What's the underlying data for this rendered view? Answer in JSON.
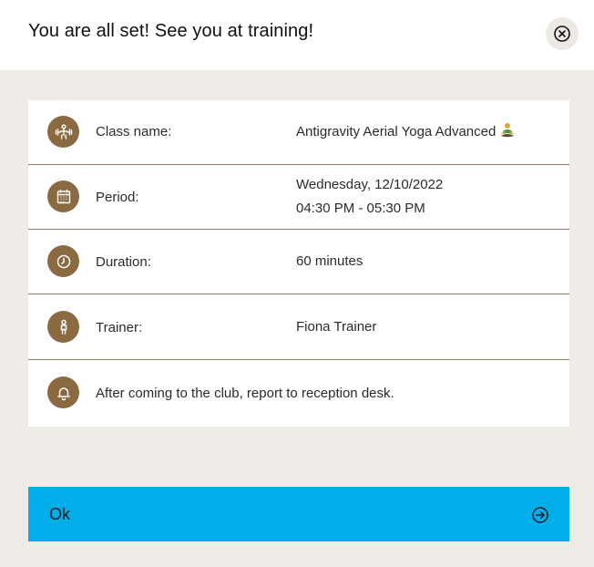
{
  "header": {
    "title": "You are all set! See you at training!",
    "close_icon": "close-circle-icon"
  },
  "details": {
    "class": {
      "icon": "fitness-icon",
      "label": "Class name:",
      "value": "Antigravity Aerial Yoga Advanced",
      "emoji_icon": "person-in-lotus-position-icon"
    },
    "period": {
      "icon": "calendar-icon",
      "label": "Period:",
      "date": "Wednesday, 12/10/2022",
      "time": "04:30 PM - 05:30 PM"
    },
    "duration": {
      "icon": "clock-icon",
      "label": "Duration:",
      "value": "60 minutes"
    },
    "trainer": {
      "icon": "person-icon",
      "label": "Trainer:",
      "value": "Fiona Trainer"
    },
    "note": {
      "icon": "bell-icon",
      "text": "After coming to the club, report to reception desk."
    }
  },
  "ok_button": {
    "label": "Ok",
    "icon": "arrow-right-circle-icon"
  },
  "colors": {
    "accent_brown": "#8b6a42",
    "button_blue": "#00aeea",
    "background": "#efebe6"
  }
}
